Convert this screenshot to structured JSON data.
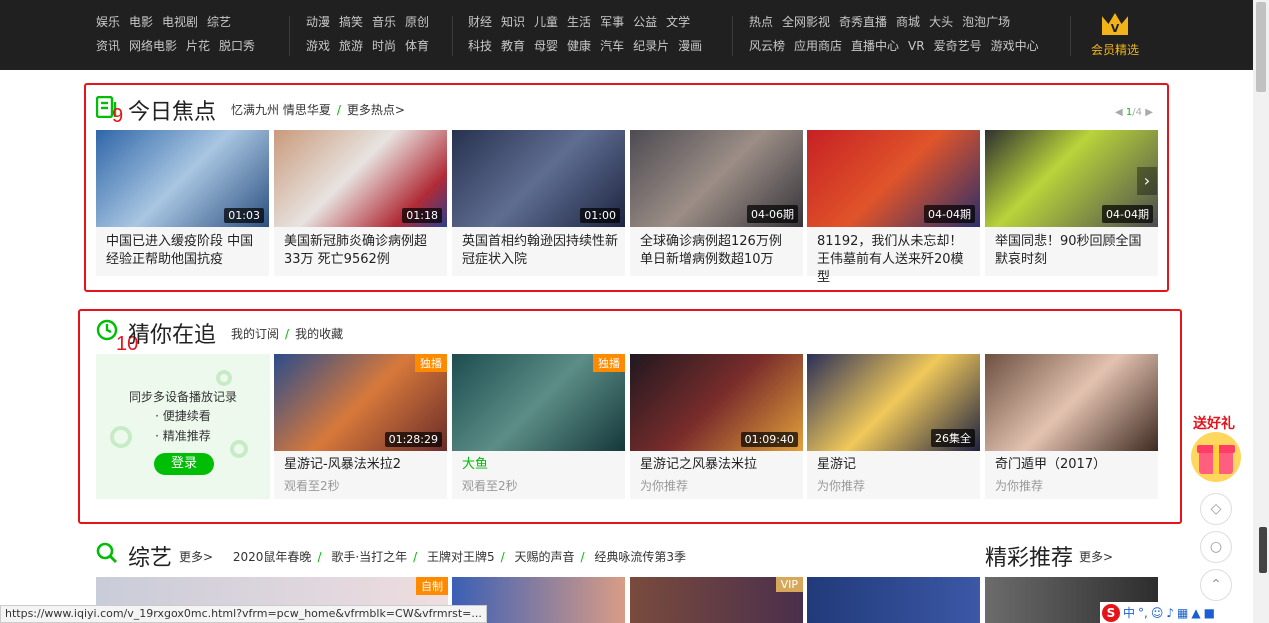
{
  "nav": {
    "group1": {
      "row1": [
        "娱乐",
        "电影",
        "电视剧",
        "综艺"
      ],
      "row2": [
        "资讯",
        "网络电影",
        "片花",
        "脱口秀"
      ]
    },
    "group2": {
      "row1": [
        "动漫",
        "搞笑",
        "音乐",
        "原创"
      ],
      "row2": [
        "游戏",
        "旅游",
        "时尚",
        "体育"
      ]
    },
    "group3": {
      "row1": [
        "财经",
        "知识",
        "儿童",
        "生活",
        "军事",
        "公益",
        "文学"
      ],
      "row2": [
        "科技",
        "教育",
        "母婴",
        "健康",
        "汽车",
        "纪录片",
        "漫画"
      ]
    },
    "group4": {
      "row1": [
        "热点",
        "全网影视",
        "奇秀直播",
        "商城",
        "大头",
        "泡泡广场"
      ],
      "row2": [
        "风云榜",
        "应用商店",
        "直播中心",
        "VR",
        "爱奇艺号",
        "游戏中心"
      ]
    },
    "vip_label": "会员精选",
    "vip_letter": "V"
  },
  "focus": {
    "title": "今日焦点",
    "annotation": "9",
    "sub": [
      "忆满九州 情思华夏",
      "更多热点>"
    ],
    "pager": {
      "current": "1",
      "total": "/4"
    },
    "cards": [
      {
        "title": "中国已进入缓疫阶段 中国经验正帮助他国抗疫",
        "duration": "01:03"
      },
      {
        "title": "美国新冠肺炎确诊病例超33万 死亡9562例",
        "duration": "01:18"
      },
      {
        "title": "英国首相约翰逊因持续性新冠症状入院",
        "duration": "01:00"
      },
      {
        "title": "全球确诊病例超126万例 单日新增病例数超10万",
        "duration": "04-06期"
      },
      {
        "title": "81192，我们从未忘却！王伟墓前有人送来歼20模型",
        "duration": "04-04期"
      },
      {
        "title": "举国同悲！90秒回顾全国默哀时刻",
        "duration": "04-04期"
      }
    ]
  },
  "guess": {
    "title": "猜你在追",
    "annotation": "10",
    "links": [
      "我的订阅",
      "我的收藏"
    ],
    "login": {
      "line1": "同步多设备播放记录",
      "line2": "· 便捷续看",
      "line3": "· 精准推荐",
      "button": "登录"
    },
    "cards": [
      {
        "title": "星游记-风暴法米拉2",
        "sub": "观看至2秒",
        "duration": "01:28:29",
        "badge": "独播"
      },
      {
        "title": "大鱼",
        "sub": "观看至2秒",
        "duration": "",
        "badge": "独播"
      },
      {
        "title": "星游记之风暴法米拉",
        "sub": "为你推荐",
        "duration": "01:09:40",
        "badge": ""
      },
      {
        "title": "星游记",
        "sub": "为你推荐",
        "duration": "26集全",
        "badge": ""
      },
      {
        "title": "奇门遁甲（2017）",
        "sub": "为你推荐",
        "duration": "",
        "badge": ""
      }
    ]
  },
  "variety": {
    "title": "综艺",
    "more": "更多>",
    "links": [
      "2020鼠年春晚",
      "歌手·当打之年",
      "王牌对王牌5",
      "天赐的声音",
      "经典咏流传第3季"
    ],
    "badges": [
      "自制",
      "VIP"
    ]
  },
  "featured": {
    "title": "精彩推荐",
    "more": "更多>"
  },
  "gift_text": "送好礼",
  "status_url": "https://www.iqiyi.com/v_19rxgox0mc.html?vfrm=pcw_home&vfrmblk=CW&vfrmrst=...",
  "ime": {
    "logo": "S",
    "lang": "中"
  },
  "colors": {
    "accent": "#00be06",
    "nav_bg": "#202020",
    "annotation_red": "#e5141b",
    "vip_gold": "#f2b31a"
  }
}
